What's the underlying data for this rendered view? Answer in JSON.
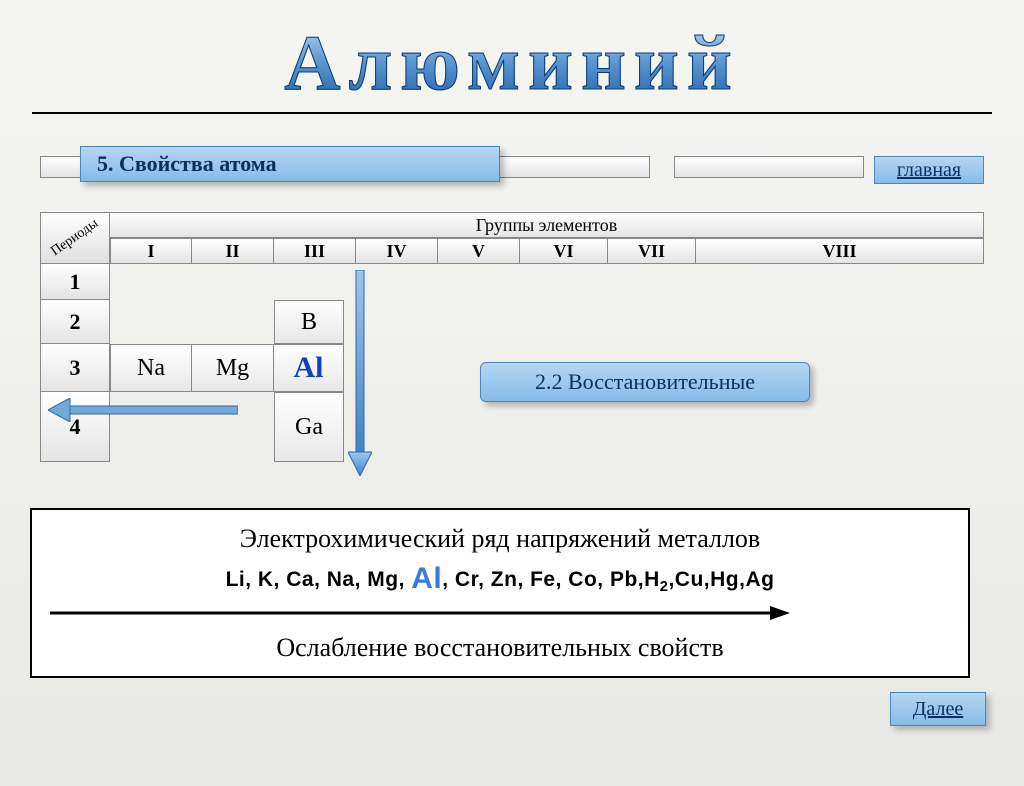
{
  "title": "Алюминий",
  "topic": "5. Свойства атома",
  "nav": {
    "home": "главная",
    "next": "Далее"
  },
  "table": {
    "periods_label": "Периоды",
    "groups_label": "Группы элементов",
    "groups": [
      "I",
      "II",
      "III",
      "IV",
      "V",
      "VI",
      "VII",
      "VIII"
    ],
    "periods": [
      "1",
      "2",
      "3",
      "4"
    ],
    "row3": {
      "na": "Na",
      "mg": "Mg",
      "al": "Al"
    },
    "col3": {
      "b": "B",
      "ga": "Ga"
    }
  },
  "property_badge": "2.2 Восстановительные",
  "series": {
    "title": "Электрохимический ряд напряжений металлов",
    "before": "Li, K, Ca, Na, Mg,",
    "highlight": "Al",
    "after": ", Cr, Zn, Fe, Co, Pb,H",
    "sub": "2",
    "tail": ",Cu,Hg,Ag",
    "caption": "Ослабление восстановительных свойств"
  }
}
